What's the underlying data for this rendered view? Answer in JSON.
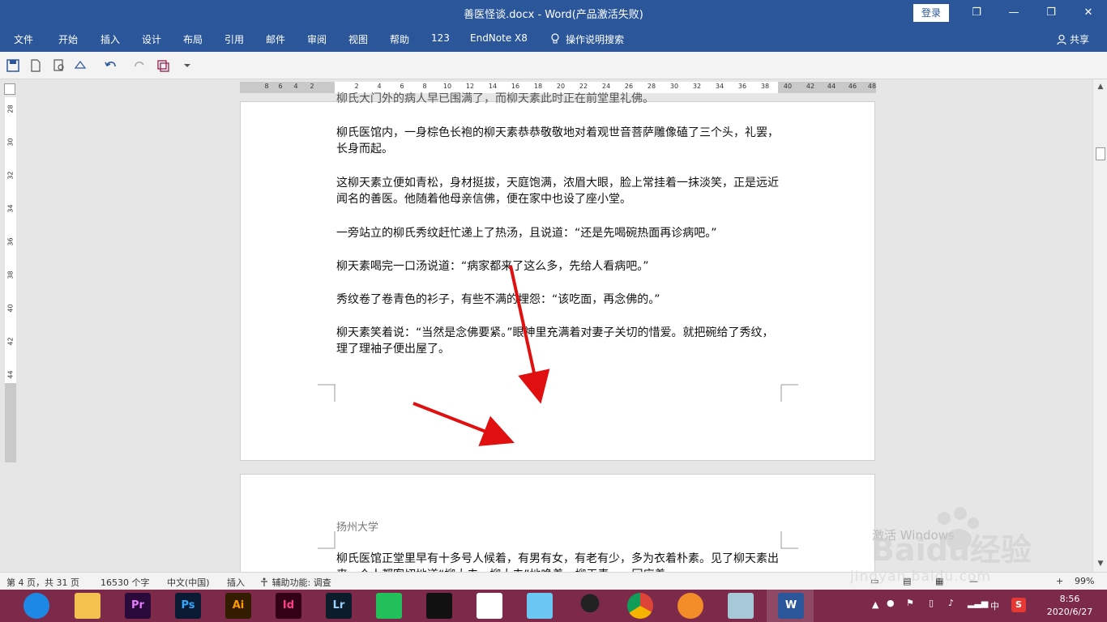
{
  "window": {
    "title": "善医怪谈.docx  -  Word(产品激活失败)",
    "login_label": "登录",
    "ribbon_icon": "❐",
    "restore_icon": "❐",
    "min_icon": "—",
    "close_icon": "✕"
  },
  "menu": {
    "tabs": [
      "文件",
      "开始",
      "插入",
      "设计",
      "布局",
      "引用",
      "邮件",
      "审阅",
      "视图",
      "帮助",
      "123",
      "EndNote X8"
    ],
    "search_label": "操作说明搜索",
    "share_label": "共享"
  },
  "ruler": {
    "h_ticks": [
      "8",
      "6",
      "4",
      "2",
      "2",
      "4",
      "6",
      "8",
      "10",
      "12",
      "14",
      "16",
      "18",
      "20",
      "22",
      "24",
      "26",
      "28",
      "30",
      "32",
      "34",
      "36",
      "38",
      "40",
      "42",
      "44",
      "46",
      "48"
    ],
    "v_ticks": [
      "28",
      "30",
      "32",
      "34",
      "36",
      "38",
      "40",
      "42",
      "44",
      "46",
      "48"
    ]
  },
  "document": {
    "top_cut_line": "柳氏大门外的病人早已围满了，而柳天素此时正在前堂里礼佛。",
    "paragraphs": [
      "柳氏医馆内，一身棕色长袍的柳天素恭恭敬敬地对着观世音菩萨雕像磕了三个头，礼罢，长身而起。",
      "这柳天素立便如青松，身材挺拔，天庭饱满，浓眉大眼，脸上常挂着一抹淡笑，正是远近闻名的善医。他随着他母亲信佛，便在家中也设了座小堂。",
      "一旁站立的柳氏秀纹赶忙递上了热汤，且说道：“还是先喝碗热面再诊病吧。”",
      "柳天素喝完一口汤说道：“病家都来了这么多，先给人看病吧。”",
      "秀纹卷了卷青色的衫子，有些不满的埋怨：“该吃面，再念佛的。”",
      "柳天素笑着说：“当然是念佛要紧。”眼神里充满着对妻子关切的惜爱。就把碗给了秀纹，理了理袖子便出屋了。"
    ],
    "page2_header": "扬州大学",
    "page2_paragraph": "柳氏医馆正堂里早有十多号人候着，有男有女，有老有少，多为衣着朴素。见了柳天素出来，众人都客切地道“柳大夫，柳大夫”地唤着，柳天素一一回应着。"
  },
  "status": {
    "page": "第 4 页，共 31 页",
    "words": "16530 个字",
    "language": "中文(中国)",
    "insert": "插入",
    "accessibility": "辅助功能: 调查",
    "zoom": "99%",
    "zoom_minus": "—",
    "zoom_plus": "+"
  },
  "taskbar": {
    "apps": [
      {
        "name": "browser",
        "label": "",
        "bg": "#1e88e5",
        "fg": "#fff"
      },
      {
        "name": "file-explorer",
        "label": "",
        "bg": "#f2c14e",
        "fg": "#fff"
      },
      {
        "name": "premiere",
        "label": "Pr",
        "bg": "#2a0a3a",
        "fg": "#e77cff"
      },
      {
        "name": "photoshop",
        "label": "Ps",
        "bg": "#0a1a33",
        "fg": "#31a8ff"
      },
      {
        "name": "illustrator",
        "label": "Ai",
        "bg": "#331c00",
        "fg": "#ff9a00"
      },
      {
        "name": "indesign",
        "label": "Id",
        "bg": "#330016",
        "fg": "#ff3d8b"
      },
      {
        "name": "lightroom",
        "label": "Lr",
        "bg": "#0b1d2b",
        "fg": "#9ad1ff"
      },
      {
        "name": "green-app",
        "label": "",
        "bg": "#22c05a",
        "fg": "#fff"
      },
      {
        "name": "video-app",
        "label": "",
        "bg": "#111",
        "fg": "#fff"
      },
      {
        "name": "media-app",
        "label": "",
        "bg": "#fff",
        "fg": "#c00"
      },
      {
        "name": "cloud-app",
        "label": "",
        "bg": "#6cc6f2",
        "fg": "#fff"
      },
      {
        "name": "qq",
        "label": "",
        "bg": "transparent",
        "fg": "#000"
      },
      {
        "name": "chrome",
        "label": "",
        "bg": "transparent",
        "fg": "#fff"
      },
      {
        "name": "foxmail",
        "label": "",
        "bg": "transparent",
        "fg": "#fff"
      },
      {
        "name": "notes-app",
        "label": "",
        "bg": "#a6c8d8",
        "fg": "#fff"
      },
      {
        "name": "word",
        "label": "W",
        "bg": "#2b579a",
        "fg": "#fff"
      }
    ],
    "ime_label": "中",
    "time": "8:56",
    "date": "2020/6/27"
  },
  "watermark": {
    "brand": "Baidu经验",
    "url": "jingyan.baidu.com",
    "activate": "激活 Windows"
  },
  "accent": "#2b579a"
}
